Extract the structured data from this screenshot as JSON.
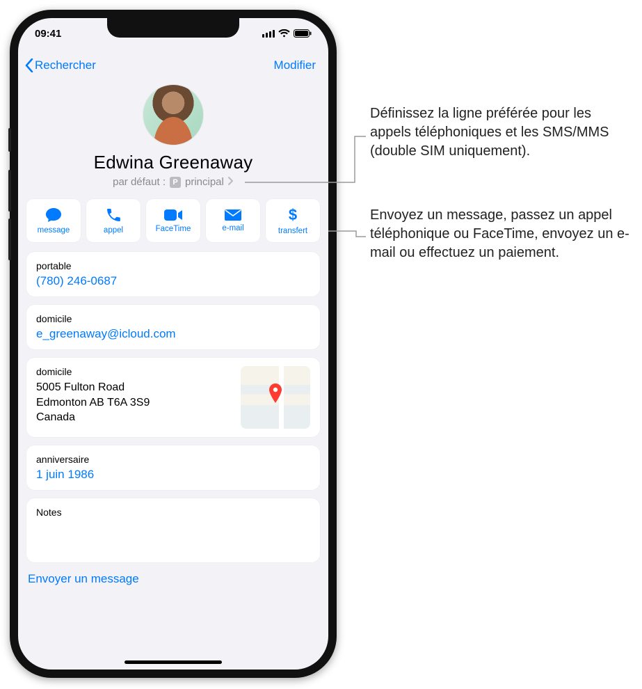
{
  "status": {
    "time": "09:41"
  },
  "nav": {
    "back": "Rechercher",
    "edit": "Modifier"
  },
  "contact": {
    "name": "Edwina Greenaway",
    "default_label": "par défaut :",
    "default_badge": "P",
    "default_value": "principal"
  },
  "actions": {
    "message": "message",
    "call": "appel",
    "facetime": "FaceTime",
    "mail": "e-mail",
    "pay": "transfert"
  },
  "phone_field": {
    "label": "portable",
    "value": "(780) 246-0687"
  },
  "email_field": {
    "label": "domicile",
    "value": "e_greenaway@icloud.com"
  },
  "address_field": {
    "label": "domicile",
    "line1": "5005 Fulton Road",
    "line2": "Edmonton AB T6A 3S9",
    "line3": "Canada"
  },
  "birthday_field": {
    "label": "anniversaire",
    "value": "1 juin 1986"
  },
  "notes": {
    "label": "Notes"
  },
  "bottom_link": "Envoyer un message",
  "callouts": {
    "c1": "Définissez la ligne préférée pour les appels téléphoniques et les SMS/MMS (double SIM uniquement).",
    "c2": "Envoyez un message, passez un appel téléphonique ou FaceTime, envoyez un e-mail ou effectuez un paiement."
  }
}
